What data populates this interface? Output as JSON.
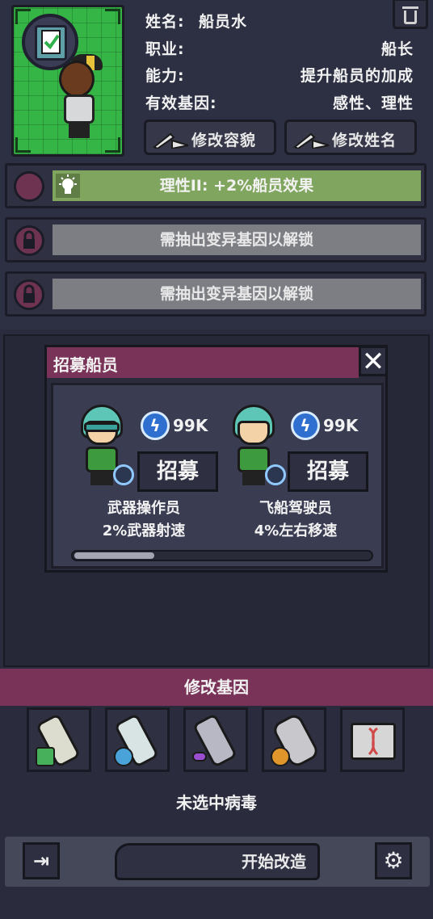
{
  "profile": {
    "name_label": "姓名:",
    "name_value": "船员水",
    "job_label": "职业:",
    "job_value": "船长",
    "ability_label": "能力:",
    "ability_value": "提升船员的加成",
    "genes_label": "有效基因:",
    "genes_value": "感性、理性",
    "edit_appearance": "修改容貌",
    "edit_name": "修改姓名",
    "portrait_badge_icon": "clipboard-check-icon"
  },
  "slots": [
    {
      "text": "理性II: +2%船员效果",
      "state": "active",
      "icon": "lightbulb-icon",
      "color": "#80a55e"
    },
    {
      "text": "需抽出变异基因以解锁",
      "state": "locked",
      "icon": "lock-icon",
      "color": "#7d7e83"
    },
    {
      "text": "需抽出变异基因以解锁",
      "state": "locked",
      "icon": "lock-icon",
      "color": "#7d7e83"
    }
  ],
  "recruit_popup": {
    "title": "招募船员",
    "close_icon": "close-icon",
    "candidates": [
      {
        "cost": "99K",
        "button": "招募",
        "name": "武器操作员",
        "effect": "2%武器射速"
      },
      {
        "cost": "99K",
        "button": "招募",
        "name": "飞船驾驶员",
        "effect": "4%左右移速"
      }
    ],
    "scroll_fraction": 0.27
  },
  "genes": {
    "title": "修改基因",
    "vials": [
      {
        "icon": "green-virus-vial-icon",
        "accent": "#46b05a"
      },
      {
        "icon": "blue-virus-vial-icon",
        "accent": "#4aa3d8"
      },
      {
        "icon": "purple-virus-vial-icon",
        "accent": "#9a4fd0"
      },
      {
        "icon": "orange-virus-vial-icon",
        "accent": "#e0962a"
      },
      {
        "icon": "red-virus-case-icon",
        "accent": "#d04848"
      }
    ],
    "status": "未选中病毒"
  },
  "bottom": {
    "start": "开始改造",
    "exit_icon": "exit-icon",
    "settings_icon": "gear-icon"
  },
  "colors": {
    "accent_magenta": "#7a3358",
    "active_green": "#80a55e",
    "portrait_green": "#35b545"
  }
}
